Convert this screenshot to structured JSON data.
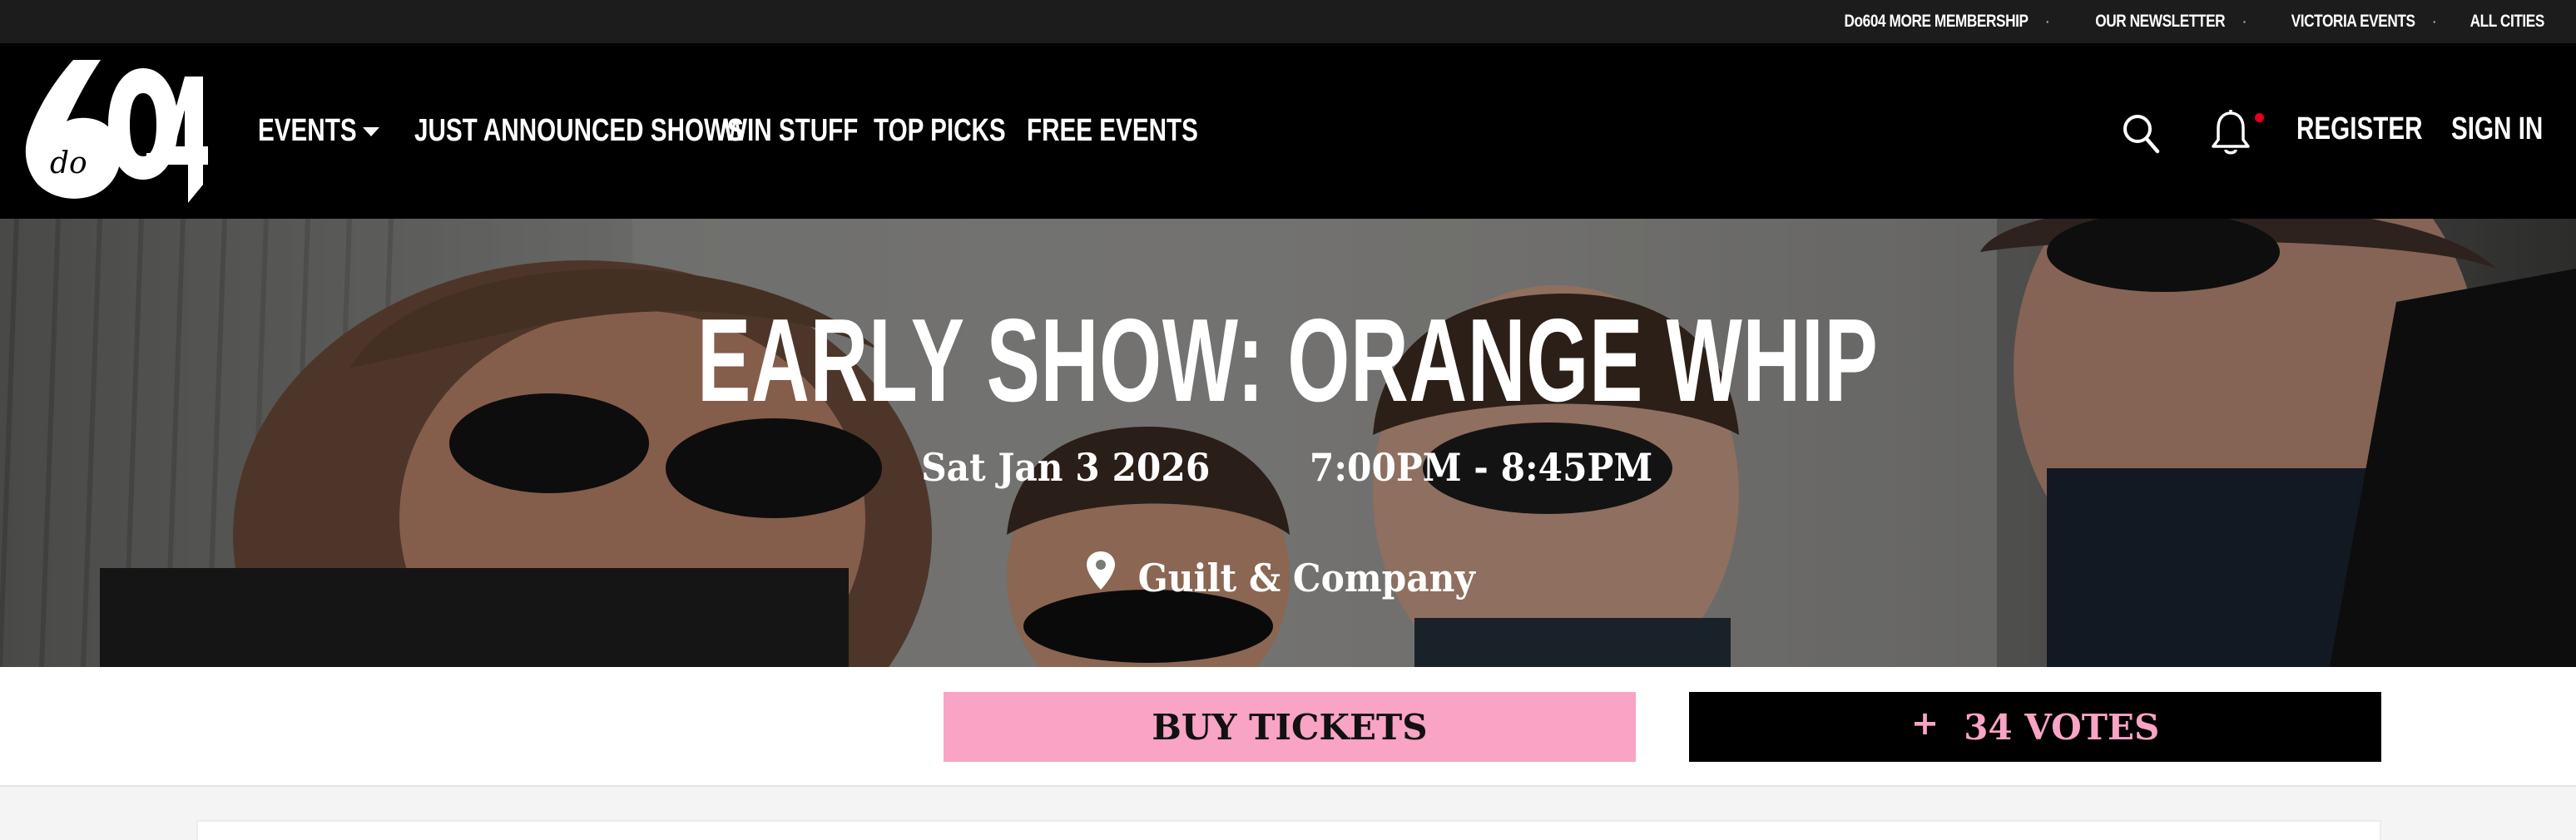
{
  "utility_bar": {
    "links": [
      {
        "label": "Do604 MORE MEMBERSHIP"
      },
      {
        "label": "OUR NEWSLETTER"
      },
      {
        "label": "VICTORIA EVENTS"
      },
      {
        "label": "ALL CITIES"
      }
    ],
    "separator": "·"
  },
  "nav": {
    "logo_icon": "do604-logo",
    "logo_text": "do",
    "links": [
      {
        "label": "EVENTS",
        "has_dropdown": true
      },
      {
        "label": "JUST ANNOUNCED SHOWS"
      },
      {
        "label": "WIN STUFF"
      },
      {
        "label": "TOP PICKS"
      },
      {
        "label": "FREE EVENTS"
      }
    ],
    "register_label": "REGISTER",
    "signin_label": "SIGN IN",
    "icons": [
      "search-icon",
      "bell-icon"
    ],
    "notification_color": "#e3001b"
  },
  "event": {
    "title": "EARLY SHOW: ORANGE WHIP",
    "date": "Sat Jan 3 2026",
    "time": "7:00PM - 8:45PM",
    "venue": "Guilt & Company"
  },
  "actions": {
    "buy_label": "BUY TICKETS",
    "vote_label": "34 VOTES",
    "vote_plus": "+",
    "accent_color": "#f9a3c5"
  }
}
